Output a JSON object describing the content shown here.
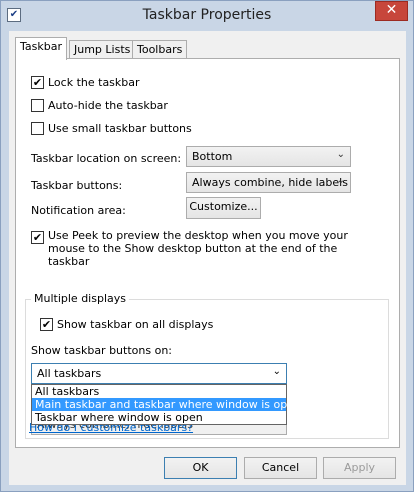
{
  "window": {
    "title": "Taskbar Properties",
    "close": "✕",
    "app_icon": "checkbox-window-icon"
  },
  "tabs": [
    {
      "label": "Taskbar",
      "active": true
    },
    {
      "label": "Jump Lists",
      "active": false
    },
    {
      "label": "Toolbars",
      "active": false
    }
  ],
  "taskbar": {
    "lock": {
      "label": "Lock the taskbar",
      "checked": true
    },
    "autohide": {
      "label": "Auto-hide the taskbar",
      "checked": false
    },
    "small": {
      "label": "Use small taskbar buttons",
      "checked": false
    },
    "location": {
      "label": "Taskbar location on screen:",
      "value": "Bottom"
    },
    "buttons": {
      "label": "Taskbar buttons:",
      "value": "Always combine, hide labels"
    },
    "notification": {
      "label": "Notification area:",
      "button": "Customize..."
    },
    "peek": {
      "label": "Use Peek to preview the desktop when you move your mouse to the Show desktop button at the end of the taskbar",
      "checked": true
    }
  },
  "multi": {
    "title": "Multiple displays",
    "show_all": {
      "label": "Show taskbar on all displays",
      "checked": true
    },
    "buttons_on_label": "Show taskbar buttons on:",
    "buttons_on_value": "All taskbars",
    "options": [
      "All taskbars",
      "Main taskbar and taskbar where window is open",
      "Taskbar where window is open"
    ],
    "selected_index": 1,
    "hidden_combo_value": "Always combine, hide labels"
  },
  "link": "How do I customize taskbars?",
  "footer": {
    "ok": "OK",
    "cancel": "Cancel",
    "apply": "Apply"
  },
  "colors": {
    "selection": "#3399ff",
    "link": "#0066cc",
    "close": "#c7463b"
  }
}
